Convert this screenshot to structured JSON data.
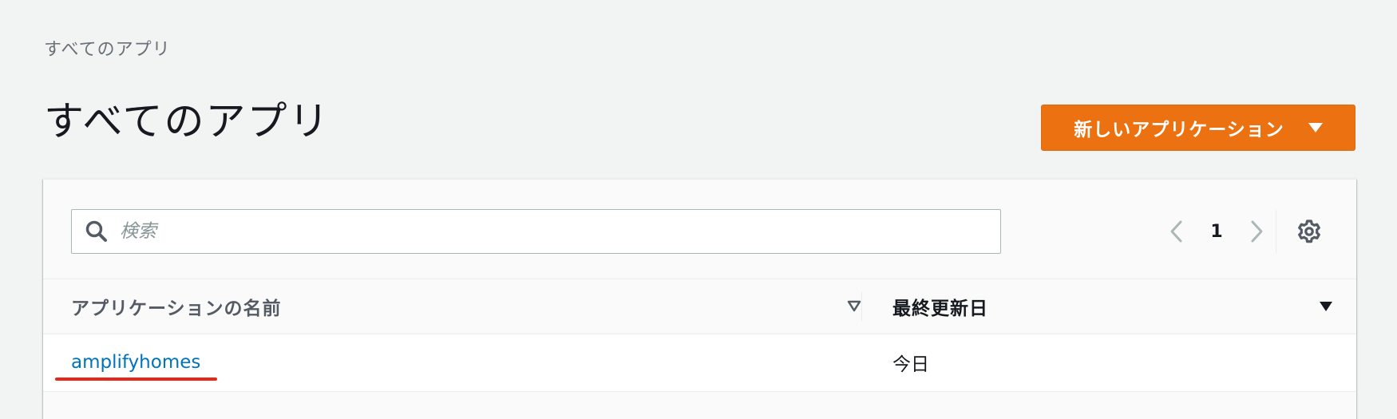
{
  "breadcrumb": {
    "label": "すべてのアプリ"
  },
  "header": {
    "title": "すべてのアプリ",
    "new_app_button_label": "新しいアプリケーション"
  },
  "search": {
    "placeholder": "検索",
    "value": ""
  },
  "pagination": {
    "current_page": "1"
  },
  "table": {
    "columns": [
      {
        "label": "アプリケーションの名前"
      },
      {
        "label": "最終更新日"
      }
    ],
    "rows": [
      {
        "name": "amplifyhomes",
        "last_updated": "今日"
      }
    ]
  },
  "colors": {
    "accent": "#ec7211",
    "link": "#0073bb",
    "annotation": "#e8271a"
  },
  "icons": {
    "search": "search-icon",
    "prev": "chevron-left-icon",
    "next": "chevron-right-icon",
    "settings": "gear-icon",
    "dropdown": "caret-down-icon"
  }
}
